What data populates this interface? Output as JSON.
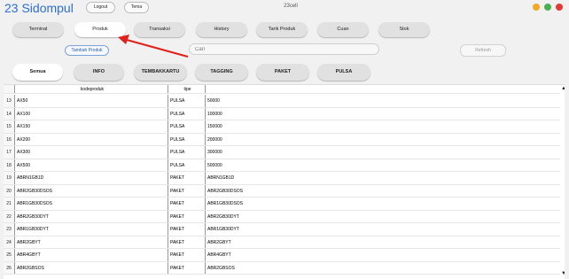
{
  "app": {
    "title": "23 Sidompul",
    "window_title": "23cell"
  },
  "header": {
    "logout_label": "Logout",
    "theme_label": "Tema"
  },
  "window_controls": {
    "colors": [
      "#f5a623",
      "#4caf50",
      "#e53935"
    ]
  },
  "nav": {
    "active": "Produk",
    "items": [
      {
        "label": "Terminal"
      },
      {
        "label": "Produk"
      },
      {
        "label": "Transaksi"
      },
      {
        "label": "History"
      },
      {
        "label": "Tarik Produk"
      },
      {
        "label": "Cuan"
      },
      {
        "label": "Stok"
      }
    ]
  },
  "toolbar": {
    "add_label": "Tambah Produk",
    "search_placeholder": "Cari",
    "refresh_label": "Refresh"
  },
  "categories": {
    "active": "Semua",
    "items": [
      {
        "label": "Semua"
      },
      {
        "label": "INFO"
      },
      {
        "label": "TEMBAKKARTU"
      },
      {
        "label": "TAGGING"
      },
      {
        "label": "PAKET"
      },
      {
        "label": "PULSA"
      }
    ]
  },
  "table": {
    "columns": [
      "kodeproduk",
      "tipe",
      ""
    ],
    "rows": [
      {
        "num": "13",
        "kode": "AX50",
        "tipe": "PULSA",
        "val": "50000"
      },
      {
        "num": "14",
        "kode": "AX100",
        "tipe": "PULSA",
        "val": "100000"
      },
      {
        "num": "15",
        "kode": "AX150",
        "tipe": "PULSA",
        "val": "150000"
      },
      {
        "num": "16",
        "kode": "AX200",
        "tipe": "PULSA",
        "val": "200000"
      },
      {
        "num": "17",
        "kode": "AX300",
        "tipe": "PULSA",
        "val": "300000"
      },
      {
        "num": "18",
        "kode": "AX500",
        "tipe": "PULSA",
        "val": "500000"
      },
      {
        "num": "19",
        "kode": "ABRN1GB1D",
        "tipe": "PAKET",
        "val": "ABRN1GB1D"
      },
      {
        "num": "20",
        "kode": "ABR2GB30DSOS",
        "tipe": "PAKET",
        "val": "ABR2GB30DSOS"
      },
      {
        "num": "21",
        "kode": "ABR1GB30DSOS",
        "tipe": "PAKET",
        "val": "ABR1GB30DSOS"
      },
      {
        "num": "22",
        "kode": "ABR2GB30DYT",
        "tipe": "PAKET",
        "val": "ABR2GB30DYT"
      },
      {
        "num": "23",
        "kode": "ABR1GB30DYT",
        "tipe": "PAKET",
        "val": "ABR1GB30DYT"
      },
      {
        "num": "24",
        "kode": "ABR2GBYT",
        "tipe": "PAKET",
        "val": "ABR2GBYT"
      },
      {
        "num": "25",
        "kode": "ABR4GBYT",
        "tipe": "PAKET",
        "val": "ABR4GBYT"
      },
      {
        "num": "26",
        "kode": "ABR2GBSOS",
        "tipe": "PAKET",
        "val": "ABR2GBSOS"
      }
    ]
  },
  "annotation": {
    "arrow_color": "#e0201a"
  }
}
